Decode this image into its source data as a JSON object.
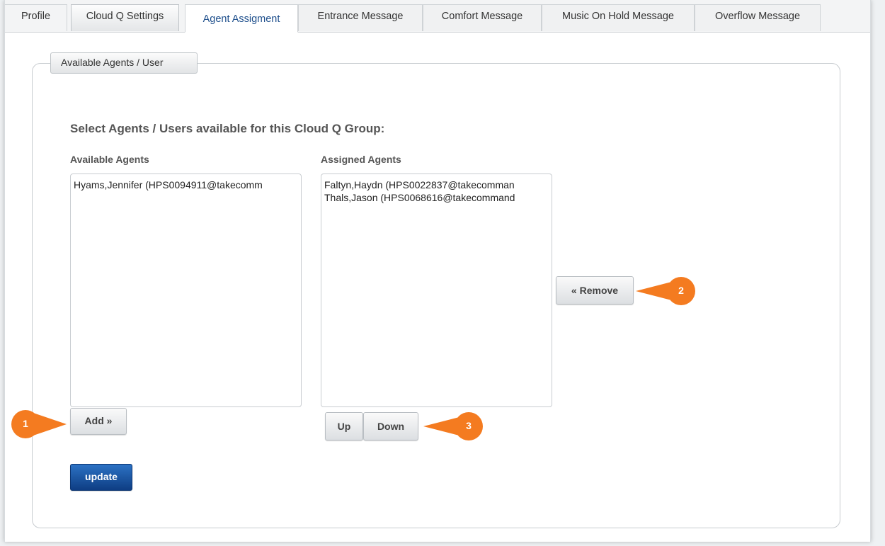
{
  "tabs": [
    {
      "label": "Profile"
    },
    {
      "label": "Cloud Q Settings"
    },
    {
      "label": "Agent Assigment"
    },
    {
      "label": "Entrance Message"
    },
    {
      "label": "Comfort Message"
    },
    {
      "label": "Music On Hold Message"
    },
    {
      "label": "Overflow Message"
    }
  ],
  "active_tab": "Agent Assigment",
  "fieldset": {
    "legend": "Available Agents / User",
    "heading": "Select Agents / Users available for this Cloud Q Group:"
  },
  "available": {
    "label": "Available Agents",
    "items": [
      "Hyams,Jennifer (HPS0094911@takecomm"
    ],
    "add_label": "Add »"
  },
  "assigned": {
    "label": "Assigned Agents",
    "items": [
      "Faltyn,Haydn (HPS0022837@takecomman",
      "Thals,Jason (HPS0068616@takecommand"
    ],
    "remove_label": "« Remove",
    "up_label": "Up",
    "down_label": "Down"
  },
  "update_label": "update",
  "callouts": [
    "1",
    "2",
    "3"
  ],
  "colors": {
    "accent": "#1e4f8c",
    "primary_button": "#0e3d83",
    "callout": "#f47b20"
  }
}
